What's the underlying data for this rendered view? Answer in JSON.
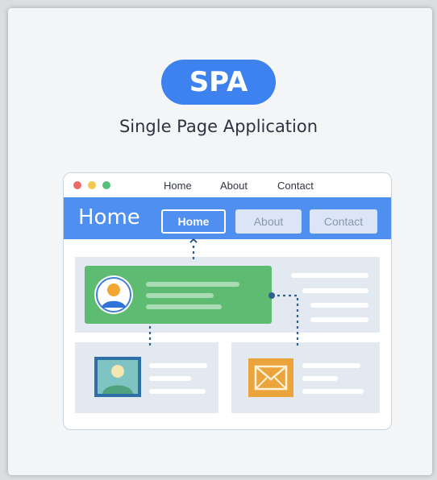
{
  "badge": {
    "label": "SPA"
  },
  "subtitle": "Single Page Application",
  "browser": {
    "chrome_links": [
      "Home",
      "About",
      "Contact"
    ],
    "dot_colors": [
      "#ef6b6b",
      "#f2c94c",
      "#55c07a"
    ]
  },
  "navbar": {
    "title": "Home",
    "buttons": [
      {
        "label": "Home",
        "state": "active"
      },
      {
        "label": "About",
        "state": "inactive"
      },
      {
        "label": "Contact",
        "state": "inactive"
      }
    ]
  },
  "icons": {
    "profile": "user-avatar-icon",
    "image": "person-photo-icon",
    "mail": "envelope-icon"
  },
  "colors": {
    "accent": "#3d82ef",
    "navbar": "#4f8fef",
    "card_green": "#5dbb72",
    "panel": "#e3e9f0",
    "connector": "#2f5e8f"
  }
}
